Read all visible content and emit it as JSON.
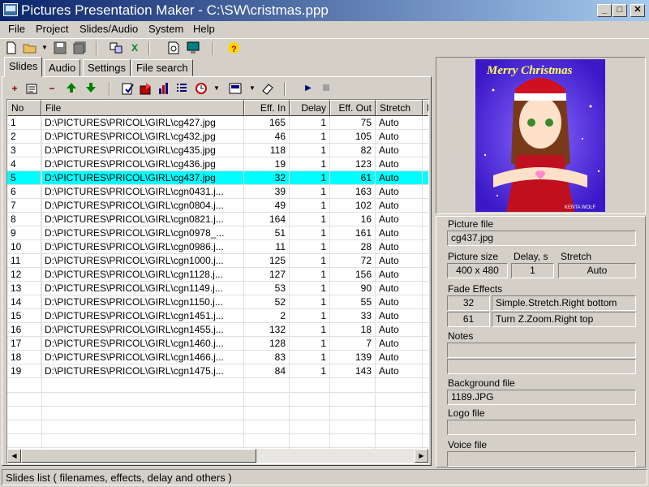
{
  "window": {
    "title": "Pictures Presentation Maker - C:\\SW\\cristmas.ppp",
    "controls": [
      "_",
      "□",
      "✕"
    ]
  },
  "menu": [
    "File",
    "Project",
    "Slides/Audio",
    "System",
    "Help"
  ],
  "toolbar_icons": [
    "new-icon",
    "open-icon",
    "open-dropdown-icon",
    "save-icon",
    "save-all-icon",
    "cut-icon",
    "excel-icon",
    "preview-icon",
    "monitor-icon",
    "help-icon"
  ],
  "tabs": [
    "Slides",
    "Audio",
    "Settings",
    "File search"
  ],
  "active_tab": "Slides",
  "slides_toolbar_icons": [
    "add-icon",
    "properties-icon",
    "remove-icon",
    "move-up-icon",
    "move-down-icon",
    "edit-icon",
    "export-icon",
    "chart-icon",
    "list-icon",
    "clock-icon",
    "clock-dropdown-icon",
    "picture-icon",
    "picture-dropdown-icon",
    "eraser-icon",
    "play-icon",
    "stop-icon"
  ],
  "columns": [
    "No",
    "File",
    "Eff. In",
    "Delay",
    "Eff. Out",
    "Stretch",
    "N"
  ],
  "rows": [
    {
      "no": "1",
      "file": "D:\\PICTURES\\PRICOL\\GIRL\\cg427.jpg",
      "eff_in": "165",
      "delay": "1",
      "eff_out": "75",
      "stretch": "Auto"
    },
    {
      "no": "2",
      "file": "D:\\PICTURES\\PRICOL\\GIRL\\cg432.jpg",
      "eff_in": "46",
      "delay": "1",
      "eff_out": "105",
      "stretch": "Auto"
    },
    {
      "no": "3",
      "file": "D:\\PICTURES\\PRICOL\\GIRL\\cg435.jpg",
      "eff_in": "118",
      "delay": "1",
      "eff_out": "82",
      "stretch": "Auto"
    },
    {
      "no": "4",
      "file": "D:\\PICTURES\\PRICOL\\GIRL\\cg436.jpg",
      "eff_in": "19",
      "delay": "1",
      "eff_out": "123",
      "stretch": "Auto"
    },
    {
      "no": "5",
      "file": "D:\\PICTURES\\PRICOL\\GIRL\\cg437.jpg",
      "eff_in": "32",
      "delay": "1",
      "eff_out": "61",
      "stretch": "Auto",
      "selected": true
    },
    {
      "no": "6",
      "file": "D:\\PICTURES\\PRICOL\\GIRL\\cgn0431.j...",
      "eff_in": "39",
      "delay": "1",
      "eff_out": "163",
      "stretch": "Auto"
    },
    {
      "no": "7",
      "file": "D:\\PICTURES\\PRICOL\\GIRL\\cgn0804.j...",
      "eff_in": "49",
      "delay": "1",
      "eff_out": "102",
      "stretch": "Auto"
    },
    {
      "no": "8",
      "file": "D:\\PICTURES\\PRICOL\\GIRL\\cgn0821.j...",
      "eff_in": "164",
      "delay": "1",
      "eff_out": "16",
      "stretch": "Auto"
    },
    {
      "no": "9",
      "file": "D:\\PICTURES\\PRICOL\\GIRL\\cgn0978_...",
      "eff_in": "51",
      "delay": "1",
      "eff_out": "161",
      "stretch": "Auto"
    },
    {
      "no": "10",
      "file": "D:\\PICTURES\\PRICOL\\GIRL\\cgn0986.j...",
      "eff_in": "11",
      "delay": "1",
      "eff_out": "28",
      "stretch": "Auto"
    },
    {
      "no": "11",
      "file": "D:\\PICTURES\\PRICOL\\GIRL\\cgn1000.j...",
      "eff_in": "125",
      "delay": "1",
      "eff_out": "72",
      "stretch": "Auto"
    },
    {
      "no": "12",
      "file": "D:\\PICTURES\\PRICOL\\GIRL\\cgn1128.j...",
      "eff_in": "127",
      "delay": "1",
      "eff_out": "156",
      "stretch": "Auto"
    },
    {
      "no": "13",
      "file": "D:\\PICTURES\\PRICOL\\GIRL\\cgn1149.j...",
      "eff_in": "53",
      "delay": "1",
      "eff_out": "90",
      "stretch": "Auto"
    },
    {
      "no": "14",
      "file": "D:\\PICTURES\\PRICOL\\GIRL\\cgn1150.j...",
      "eff_in": "52",
      "delay": "1",
      "eff_out": "55",
      "stretch": "Auto"
    },
    {
      "no": "15",
      "file": "D:\\PICTURES\\PRICOL\\GIRL\\cgn1451.j...",
      "eff_in": "2",
      "delay": "1",
      "eff_out": "33",
      "stretch": "Auto"
    },
    {
      "no": "16",
      "file": "D:\\PICTURES\\PRICOL\\GIRL\\cgn1455.j...",
      "eff_in": "132",
      "delay": "1",
      "eff_out": "18",
      "stretch": "Auto"
    },
    {
      "no": "17",
      "file": "D:\\PICTURES\\PRICOL\\GIRL\\cgn1460.j...",
      "eff_in": "128",
      "delay": "1",
      "eff_out": "7",
      "stretch": "Auto"
    },
    {
      "no": "18",
      "file": "D:\\PICTURES\\PRICOL\\GIRL\\cgn1466.j...",
      "eff_in": "83",
      "delay": "1",
      "eff_out": "139",
      "stretch": "Auto"
    },
    {
      "no": "19",
      "file": "D:\\PICTURES\\PRICOL\\GIRL\\cgn1475.j...",
      "eff_in": "84",
      "delay": "1",
      "eff_out": "143",
      "stretch": "Auto"
    }
  ],
  "preview": {
    "caption": "Merry Christmas",
    "signature": "KENTA WOLF"
  },
  "details": {
    "picture_file_label": "Picture file",
    "picture_file": "cg437.jpg",
    "picture_size_label": "Picture size",
    "picture_size": "400 x 480",
    "delay_label": "Delay, s",
    "delay": "1",
    "stretch_label": "Stretch",
    "stretch": "Auto",
    "fade_label": "Fade Effects",
    "fade_in_value": "32",
    "fade_in_name": "Simple.Stretch.Right bottom",
    "fade_out_value": "61",
    "fade_out_name": "Turn Z.Zoom.Right top",
    "notes_label": "Notes",
    "notes_line1": "",
    "notes_line2": "",
    "background_label": "Background file",
    "background_file": "1189.JPG",
    "logo_label": "Logo file",
    "logo_file": "",
    "voice_label": "Voice file",
    "voice_file": ""
  },
  "status_text": "Slides list ( filenames, effects, delay and others )",
  "colors": {
    "titlebar_start": "#0a246a",
    "titlebar_end": "#a6caf0",
    "selection": "#00ffff",
    "face": "#d4d0c8"
  }
}
